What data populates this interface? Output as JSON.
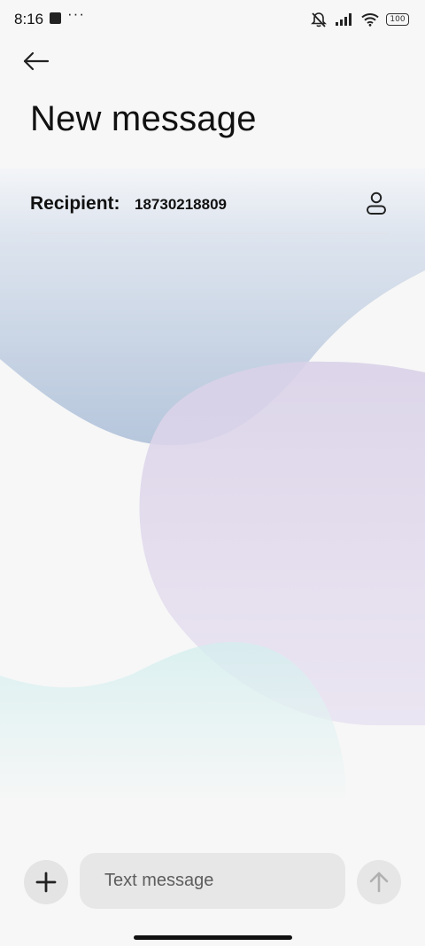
{
  "status_bar": {
    "time": "8:16",
    "more_indicator": "···",
    "battery_level": "100",
    "icons": [
      "notification-square-icon",
      "mute-bell-icon",
      "signal-icon",
      "wifi-icon",
      "battery-icon"
    ]
  },
  "header": {
    "back_icon": "back-arrow-icon",
    "title": "New message"
  },
  "recipient": {
    "label": "Recipient:",
    "value": "18730218809",
    "contact_icon": "contact-person-icon"
  },
  "composer": {
    "add_icon": "plus-icon",
    "placeholder": "Text message",
    "send_icon": "send-arrow-up-icon"
  },
  "colors": {
    "background": "#f7f7f7",
    "blue_blob": "#b9c8dc",
    "purple_blob": "#ddd5ea",
    "teal_blob": "#d6f0ef",
    "input_background": "#e7e7e7"
  }
}
